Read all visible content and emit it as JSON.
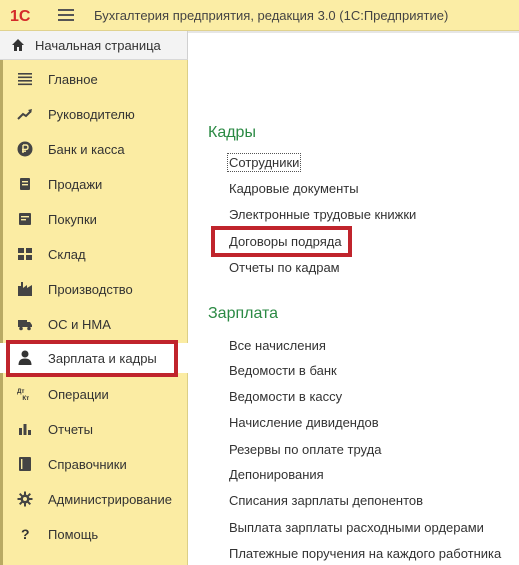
{
  "window": {
    "logo_text": "1С",
    "title": "Бухгалтерия предприятия, редакция 3.0  (1С:Предприятие)"
  },
  "home_tab": {
    "label": "Начальная страница",
    "icon": "home-icon"
  },
  "sidebar": {
    "items": [
      {
        "label": "Главное",
        "icon": "menu-lines-icon"
      },
      {
        "label": "Руководителю",
        "icon": "trend-up-icon"
      },
      {
        "label": "Банк и касса",
        "icon": "ruble-coin-icon"
      },
      {
        "label": "Продажи",
        "icon": "cart-icon"
      },
      {
        "label": "Покупки",
        "icon": "basket-icon"
      },
      {
        "label": "Склад",
        "icon": "warehouse-grid-icon"
      },
      {
        "label": "Производство",
        "icon": "factory-icon"
      },
      {
        "label": "ОС и НМА",
        "icon": "truck-icon"
      },
      {
        "label": "Зарплата и кадры",
        "icon": "person-icon",
        "active": true
      },
      {
        "label": "Операции",
        "icon": "debit-credit-icon",
        "icon_text": "Дт Кт"
      },
      {
        "label": "Отчеты",
        "icon": "bar-chart-icon"
      },
      {
        "label": "Справочники",
        "icon": "book-icon"
      },
      {
        "label": "Администрирование",
        "icon": "gear-icon"
      },
      {
        "label": "Помощь",
        "icon": "question-icon",
        "icon_text": "?"
      }
    ]
  },
  "main": {
    "sections": [
      {
        "title": "Кадры",
        "links": [
          "Сотрудники",
          "Кадровые документы",
          "Электронные трудовые книжки",
          "Договоры подряда",
          "Отчеты по кадрам"
        ]
      },
      {
        "title": "Зарплата",
        "links": [
          "Все начисления",
          "Ведомости в банк",
          "Ведомости в кассу",
          "Начисление дивидендов",
          "Резервы по оплате труда",
          "Депонирования",
          "Списания зарплаты депонентов",
          "Выплата зарплаты расходными ордерами",
          "Платежные поручения на каждого работника"
        ]
      }
    ]
  },
  "colors": {
    "sidebar_bg": "#fbeca3",
    "section_title": "#2b8a44",
    "highlight_frame": "#c0242c",
    "logo_red": "#d42a2a"
  }
}
